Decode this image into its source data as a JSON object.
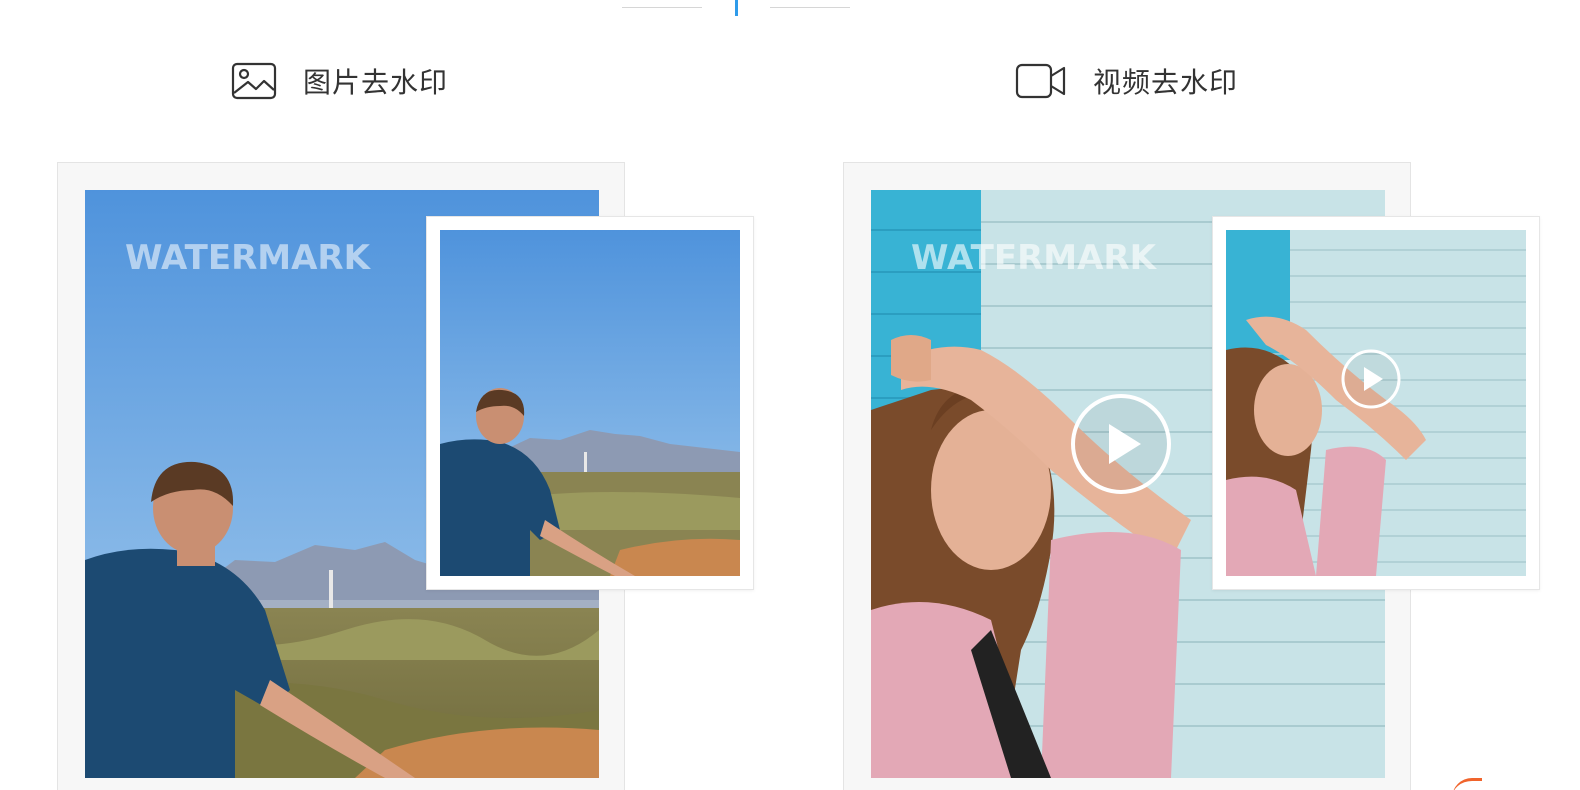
{
  "sections": {
    "image": {
      "label": "图片去水印",
      "icon": "image-icon",
      "watermark_text": "WATERMARK"
    },
    "video": {
      "label": "视频去水印",
      "icon": "video-camera-icon",
      "watermark_text": "WATERMARK"
    }
  },
  "colors": {
    "accent": "#2f9bea",
    "sky": "#5d9fe0",
    "brick_blue": "#3bb6d6",
    "brick_white": "#c9e4e8",
    "card_bg": "#f7f7f7",
    "orange_accent": "#f0642c"
  }
}
